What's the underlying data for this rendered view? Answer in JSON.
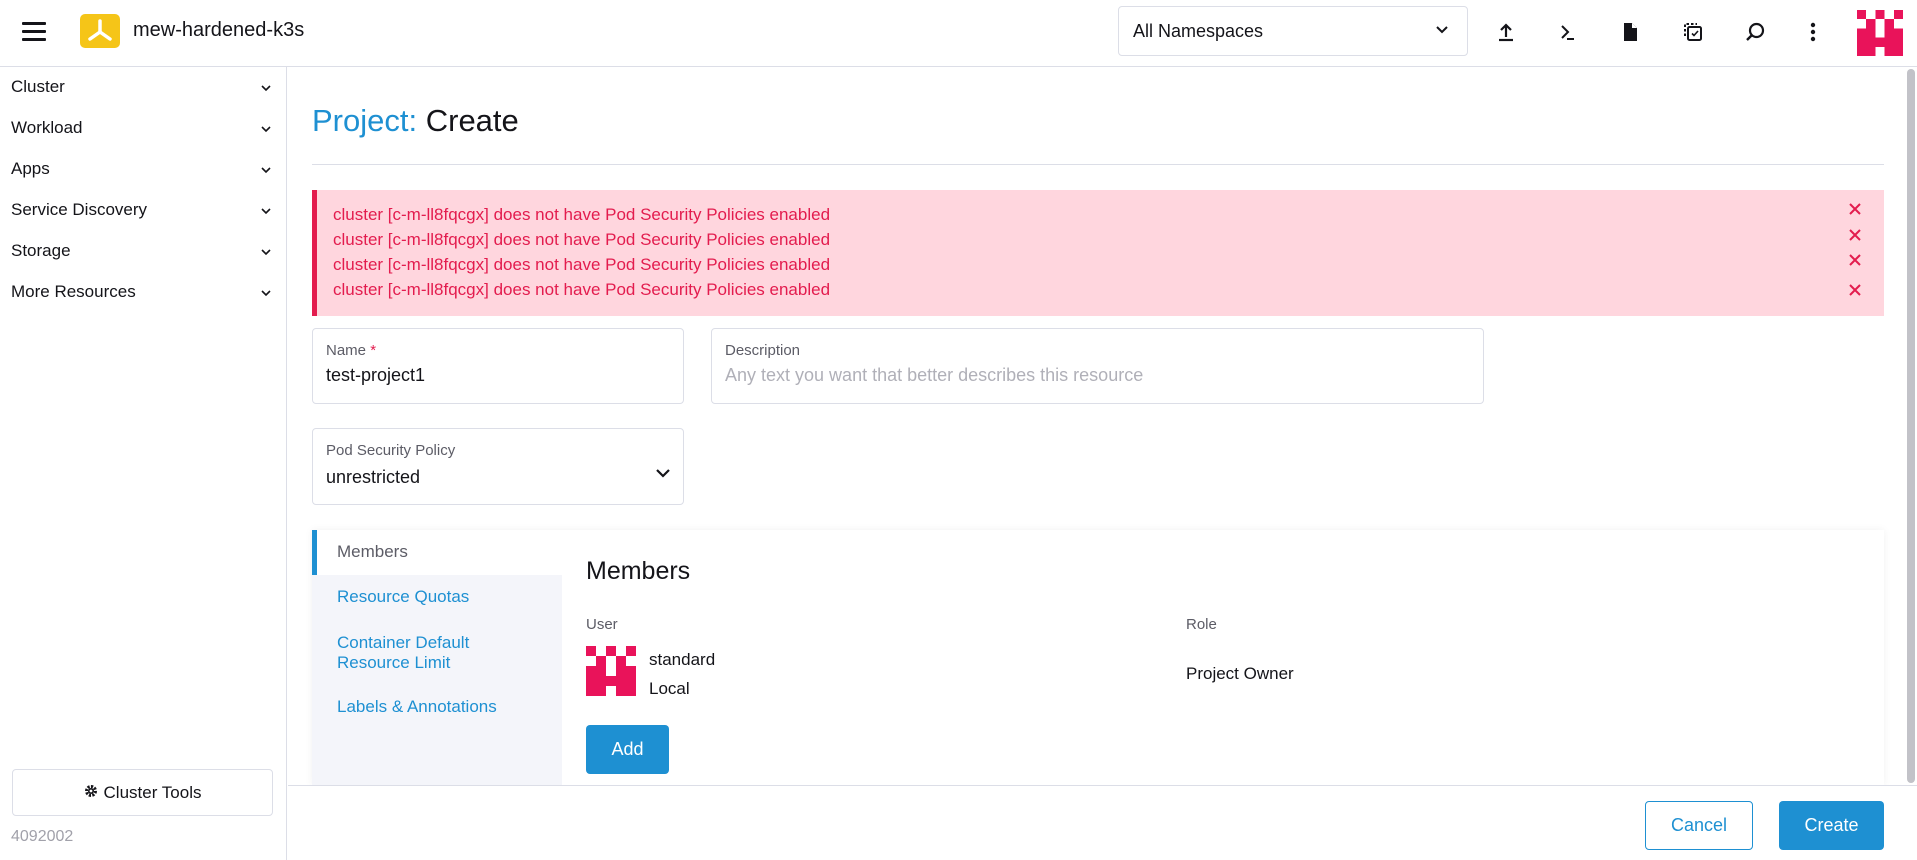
{
  "header": {
    "cluster_name": "mew-hardened-k3s",
    "namespace_select": "All Namespaces",
    "icons": [
      "upload-icon",
      "shell-icon",
      "file-icon",
      "copy-config-icon",
      "search-icon",
      "more-vert-icon"
    ]
  },
  "sidebar": {
    "items": [
      {
        "label": "Cluster"
      },
      {
        "label": "Workload"
      },
      {
        "label": "Apps"
      },
      {
        "label": "Service Discovery"
      },
      {
        "label": "Storage"
      },
      {
        "label": "More Resources"
      }
    ],
    "tools_label": "Cluster Tools",
    "version": "4092002"
  },
  "page": {
    "title_prefix": "Project:",
    "title_action": "Create"
  },
  "errors": [
    "cluster [c-m-ll8fqcgx] does not have Pod Security Policies enabled",
    "cluster [c-m-ll8fqcgx] does not have Pod Security Policies enabled",
    "cluster [c-m-ll8fqcgx] does not have Pod Security Policies enabled",
    "cluster [c-m-ll8fqcgx] does not have Pod Security Policies enabled"
  ],
  "form": {
    "name_label": "Name",
    "name_required": "*",
    "name_value": "test-project1",
    "description_label": "Description",
    "description_placeholder": "Any text you want that better describes this resource",
    "psp_label": "Pod Security Policy",
    "psp_value": "unrestricted"
  },
  "tabs": [
    {
      "label": "Members",
      "active": true
    },
    {
      "label": "Resource Quotas"
    },
    {
      "label": "Container Default Resource Limit"
    },
    {
      "label": "Labels & Annotations"
    }
  ],
  "members": {
    "title": "Members",
    "user_header": "User",
    "role_header": "Role",
    "rows": [
      {
        "name": "standard",
        "provider": "Local",
        "role": "Project Owner"
      }
    ],
    "add_label": "Add"
  },
  "footer": {
    "cancel_label": "Cancel",
    "create_label": "Create"
  },
  "colors": {
    "accent": "#1e90d2",
    "error": "#e31c4e",
    "error_bg": "#ffd6de",
    "cluster_badge": "#f5c518",
    "avatar": "#e9135a"
  }
}
